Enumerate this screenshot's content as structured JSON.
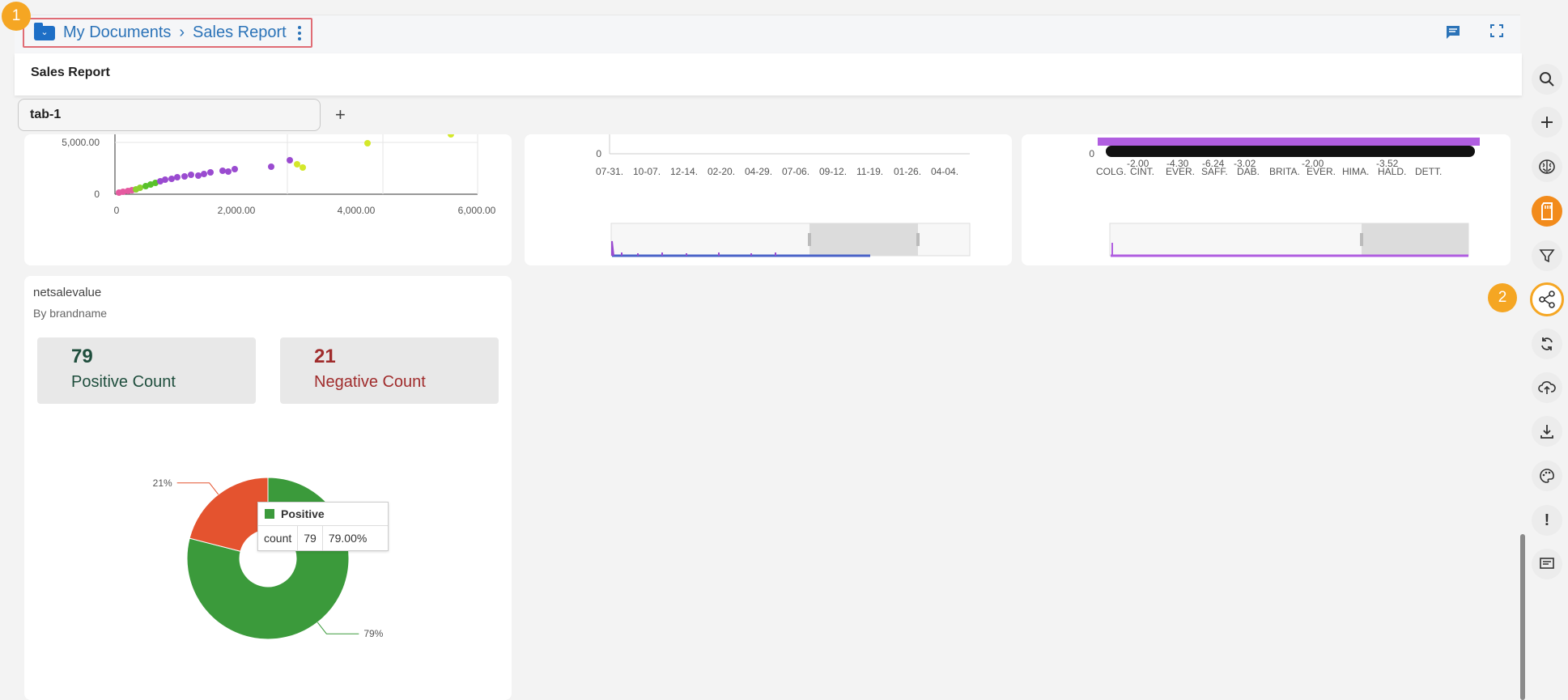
{
  "breadcrumb": {
    "root": "My Documents",
    "current": "Sales Report"
  },
  "badges": {
    "one": "1",
    "two": "2"
  },
  "title": "Sales Report",
  "tabs": [
    {
      "label": "tab-1"
    }
  ],
  "tab_add_label": "+",
  "icons": {
    "comment": "comment-icon",
    "fullscreen": "fullscreen-icon",
    "sidebar": [
      "search-icon",
      "plus-icon",
      "brain-icon",
      "sd-card-icon",
      "filter-icon",
      "share-icon",
      "refresh-icon",
      "cloud-upload-icon",
      "download-icon",
      "palette-icon",
      "info-icon",
      "message-icon"
    ]
  },
  "colors": {
    "accent": "#f5a623",
    "primary": "#2b73b8",
    "positive": "#3b9a3b",
    "negative": "#e4532f",
    "positive_text": "#1f4e3d",
    "negative_text": "#a02c2c"
  },
  "scatter": {
    "y_ticks": [
      "5,000.00",
      "0"
    ],
    "x_ticks": [
      "0",
      "2,000.00",
      "4,000.00",
      "6,000.00"
    ]
  },
  "timeline": {
    "y_tick": "0",
    "x_ticks": [
      "07-31.",
      "10-07.",
      "12-14.",
      "02-20.",
      "04-29.",
      "07-06.",
      "09-12.",
      "11-19.",
      "01-26.",
      "04-04."
    ]
  },
  "brands": {
    "y_tick": "0",
    "value_labels": [
      "-2.00",
      "-4.30",
      "-6.24",
      "-3.02",
      "-2.00",
      "-3.52"
    ],
    "x_ticks": [
      "COLG.",
      "CINT.",
      "EVER.",
      "SAFF.",
      "DAB.",
      "BRITA.",
      "EVER.",
      "HIMA.",
      "HALD.",
      "DETT."
    ]
  },
  "kpi_widget": {
    "title": "netsalevalue",
    "subtitle": "By brandname",
    "positive": {
      "value": "79",
      "label": "Positive Count"
    },
    "negative": {
      "value": "21",
      "label": "Negative Count"
    }
  },
  "chart_data": {
    "type": "pie",
    "categories": [
      "Positive",
      "Negative"
    ],
    "values": [
      79,
      21
    ],
    "percent_labels": [
      "79%",
      "21%"
    ],
    "colors": [
      "#3b9a3b",
      "#e4532f"
    ],
    "tooltip": {
      "series": "Positive",
      "metric": "count",
      "value": "79",
      "percent": "79.00%"
    }
  }
}
